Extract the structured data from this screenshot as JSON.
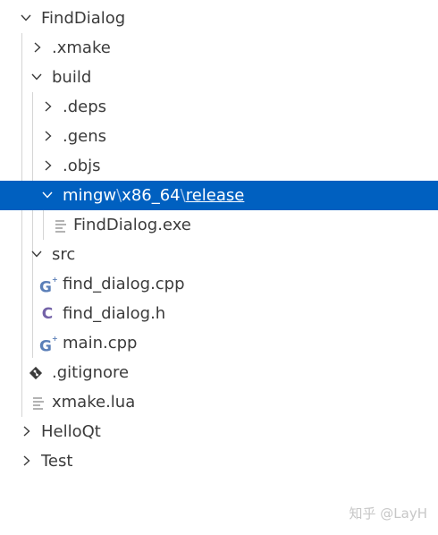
{
  "tree": [
    {
      "label": "FindDialog",
      "expanded": true
    },
    {
      "label": ".xmake",
      "expanded": false
    },
    {
      "label": "build",
      "expanded": true
    },
    {
      "label": ".deps",
      "expanded": false
    },
    {
      "label": ".gens",
      "expanded": false
    },
    {
      "label": ".objs",
      "expanded": false
    },
    {
      "label_parts": [
        "mingw",
        "\\",
        "x86_64",
        "\\",
        "release"
      ],
      "expanded": true,
      "selected": true
    },
    {
      "label": "FindDialog.exe",
      "icon": "lines-file-icon"
    },
    {
      "label": "src",
      "expanded": true
    },
    {
      "label": "find_dialog.cpp",
      "icon": "cpp-file-icon"
    },
    {
      "label": "find_dialog.h",
      "icon": "c-header-icon"
    },
    {
      "label": "main.cpp",
      "icon": "cpp-file-icon"
    },
    {
      "label": ".gitignore",
      "icon": "git-diamond-icon"
    },
    {
      "label": "xmake.lua",
      "icon": "lines-file-icon"
    },
    {
      "label": "HelloQt",
      "expanded": false
    },
    {
      "label": "Test",
      "expanded": false
    }
  ],
  "icon_glyphs": {
    "cpp": "G",
    "header": "C"
  },
  "colors": {
    "selection": "#0060c0",
    "cpp_icon": "#5b7fb8",
    "header_icon": "#7463a8"
  },
  "watermark": "知乎 @LayH"
}
